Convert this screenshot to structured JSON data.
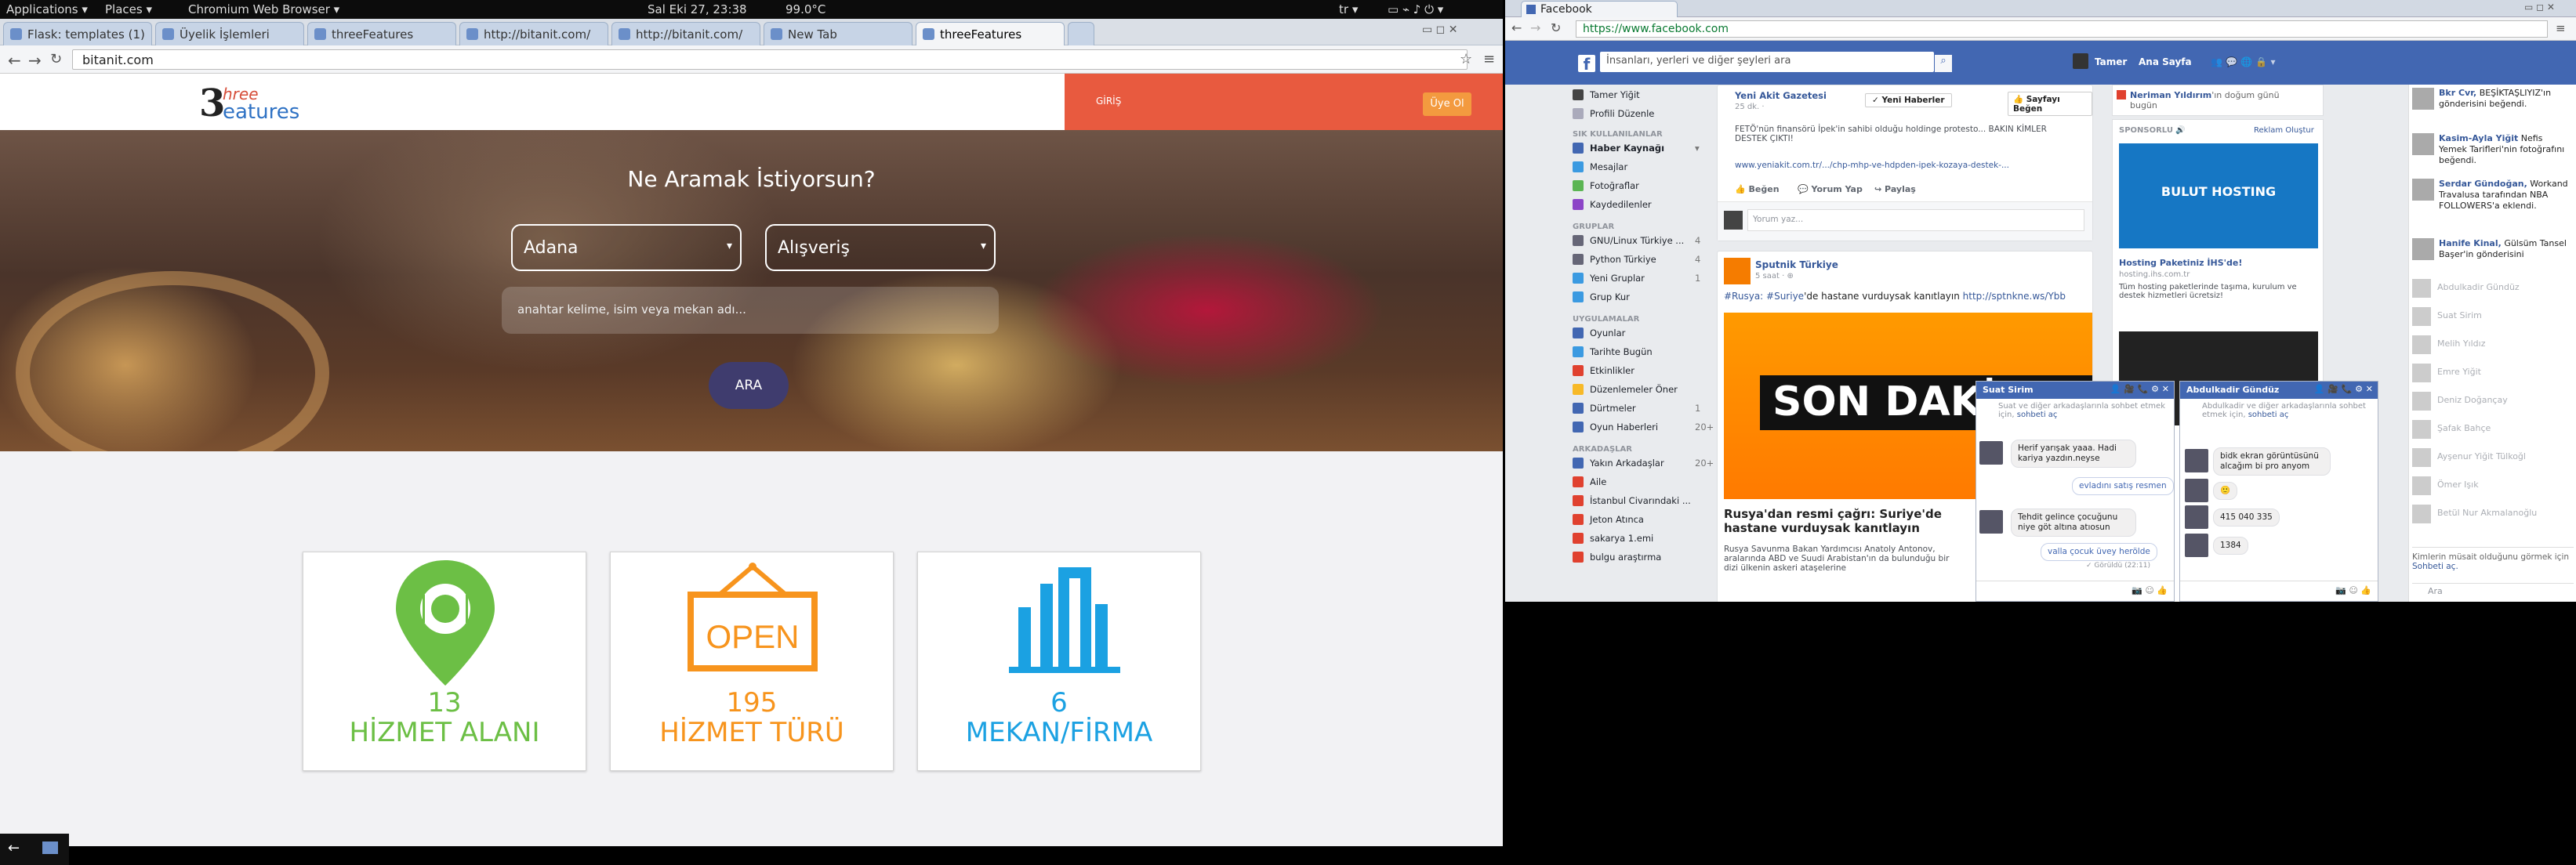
{
  "gnome": {
    "applications": "Applications ▾",
    "places": "Places ▾",
    "browser": "Chromium Web Browser ▾",
    "clock": "Sal Eki 27, 23:38",
    "temp": "99.0°C",
    "lang": "tr ▾"
  },
  "left_tabs": [
    "Flask: templates (1)",
    "Üyelik İşlemleri",
    "threeFeatures",
    "http://bitanit.com/",
    "http://bitanit.com/",
    "New Tab",
    "threeFeatures"
  ],
  "left_url": "bitanit.com",
  "site": {
    "logo": {
      "n": "3",
      "top": "hree",
      "bottom": "eatures"
    },
    "giris": "GİRİŞ",
    "uye_ol": "Üye Ol",
    "hero_title": "Ne Aramak İstiyorsun?",
    "city": "Adana",
    "category": "Alışveriş",
    "keyword_placeholder": "anahtar kelime, isim veya mekan adı...",
    "search_button": "ARA",
    "cards": [
      {
        "number": "13",
        "label": "HİZMET ALANI",
        "color": "#6cbf45",
        "icon": "map-pin-utensils-icon"
      },
      {
        "number": "195",
        "label": "HİZMET TÜRÜ",
        "color": "#f7941d",
        "icon": "open-sign-icon",
        "sign": "OPEN"
      },
      {
        "number": "6",
        "label": "MEKAN/FİRMA",
        "color": "#1ba1e2",
        "icon": "buildings-icon"
      }
    ]
  },
  "fb": {
    "tab_title": "Facebook",
    "url": "https://www.facebook.com",
    "search_placeholder": "İnsanları, yerleri ve diğer şeyleri ara",
    "user": "Tamer",
    "home": "Ana Sayfa",
    "left": {
      "profile": "Tamer Yiğit",
      "edit": "Profili Düzenle",
      "favorites_title": "SIK KULLANILANLAR",
      "favorites": [
        {
          "label": "Haber Kaynağı",
          "count": "▾"
        },
        {
          "label": "Mesajlar",
          "count": ""
        },
        {
          "label": "Fotoğraflar",
          "count": ""
        },
        {
          "label": "Kaydedilenler",
          "count": ""
        }
      ],
      "groups_title": "GRUPLAR",
      "groups": [
        {
          "label": "GNU/Linux Türkiye ...",
          "count": "4"
        },
        {
          "label": "Python Türkiye",
          "count": "4"
        },
        {
          "label": "Yeni Gruplar",
          "count": "1"
        },
        {
          "label": "Grup Kur",
          "count": ""
        }
      ],
      "apps_title": "UYGULAMALAR",
      "apps": [
        {
          "label": "Oyunlar",
          "count": ""
        },
        {
          "label": "Tarihte Bugün",
          "count": ""
        },
        {
          "label": "Etkinlikler",
          "count": ""
        },
        {
          "label": "Düzenlemeler Öner",
          "count": ""
        },
        {
          "label": "Dürtmeler",
          "count": "1"
        },
        {
          "label": "Oyun Haberleri",
          "count": "20+"
        }
      ],
      "friends_title": "ARKADAŞLAR",
      "friends": [
        {
          "label": "Yakın Arkadaşlar",
          "count": "20+"
        },
        {
          "label": "Aile",
          "count": ""
        },
        {
          "label": "İstanbul Civarındaki ...",
          "count": ""
        },
        {
          "label": "Jeton Atınca",
          "count": ""
        },
        {
          "label": "sakarya 1.emi",
          "count": ""
        },
        {
          "label": "bulgu araştırma",
          "count": ""
        }
      ]
    },
    "post1": {
      "page": "Yeni Akit Gazetesi",
      "time": "25 dk. ·",
      "follow": "✓ Yeni Haberler",
      "like_page": "👍 Sayfayı Beğen",
      "text": "FETÖ'nün finansörü İpek'in sahibi olduğu holdinge protesto... BAKIN KİMLER DESTEK ÇIKTI!",
      "link": "www.yeniakit.com.tr/.../chp-mhp-ve-hdpden-ipek-kozaya-destek-...",
      "like": "Beğen",
      "comment": "Yorum Yap",
      "share": "Paylaş",
      "comment_ph": "Yorum yaz..."
    },
    "post2": {
      "page": "Sputnik Türkiye",
      "time": "5 saat · ⊕",
      "text_tags": "#Rusya: #Suriye",
      "text": "'de hastane vurduysak kanıtlayın ",
      "link": "http://sptnkne.ws/Ybb",
      "banner": "SON DAKİKA",
      "title": "Rusya'dan resmi çağrı: Suriye'de hastane vurduysak kanıtlayın",
      "desc": "Rusya Savunma Bakan Yardımcısı Anatoly Antonov, aralarında ABD ve Suudi Arabistan'ın da bulunduğu bir dizi ülkenin askeri ataşelerine"
    },
    "birthday": {
      "name": "Neriman Yıldırım",
      "text": "'ın doğum günü bugün"
    },
    "sponsored": "SPONSORLU 🔊",
    "create_ad": "Reklam Oluştur",
    "ad": {
      "brand": "BULUT HOSTING",
      "title": "Hosting Paketiniz İHS'de!",
      "domain": "hosting.ihs.com.tr",
      "desc": "Tüm hosting paketlerinde taşıma, kurulum ve destek hizmetleri ücretsiz!"
    },
    "ticker": [
      {
        "name": "Bkr Cvr,",
        "text": "BEŞİKTAŞLIYIZ'ın gönderisini beğendi."
      },
      {
        "name": "Kasim-Ayla Yiğit",
        "text": "Nefis Yemek Tarifleri'nin fotoğrafını beğendi."
      },
      {
        "name": "Serdar Gündoğan,",
        "text": "Workand Travalusa tarafından NBA FOLLOWERS'a eklendi."
      },
      {
        "name": "Hanife Kinal,",
        "text": "Gülsüm Tansel Başer'in gönderisini"
      }
    ],
    "online": [
      "Abdulkadir Gündüz",
      "Suat Sirim",
      "Melih Yıldız",
      "Emre Yiğit",
      "Deniz Doğançay",
      "Şafak Bahçe",
      "Ayşenur Yiğit Tülkoğl",
      "Ömer Işık",
      "Betül Nur Akmalanoğlu"
    ],
    "ticker_bottom": {
      "text": "Kimlerin müsait olduğunu görmek için ",
      "link": "Sohbeti aç.",
      "search": "Ara"
    },
    "chat1": {
      "name": "Suat Sirim",
      "notice": "Suat ve diğer arkadaşlarınla sohbet etmek için, ",
      "notice_link": "sohbeti aç",
      "msgs": [
        "Herif yarışak yaaa. Hadi kariya yazdın.neyse",
        "evladını satış resmen",
        "Tehdit gelince çocuğunu niye göt altına atıosun",
        "valla çocuk üvey herölde"
      ],
      "seen": "✓ Görüldü (22:11)"
    },
    "chat2": {
      "name": "Abdulkadir Gündüz",
      "notice": "Abdulkadir ve diğer arkadaşlarınla sohbet etmek için, ",
      "notice_link": "sohbeti aç",
      "msgs": [
        "bidk ekran görüntüsünü alcağım bi pro anyom",
        "🙂",
        "415 040 335",
        "1384"
      ]
    }
  }
}
